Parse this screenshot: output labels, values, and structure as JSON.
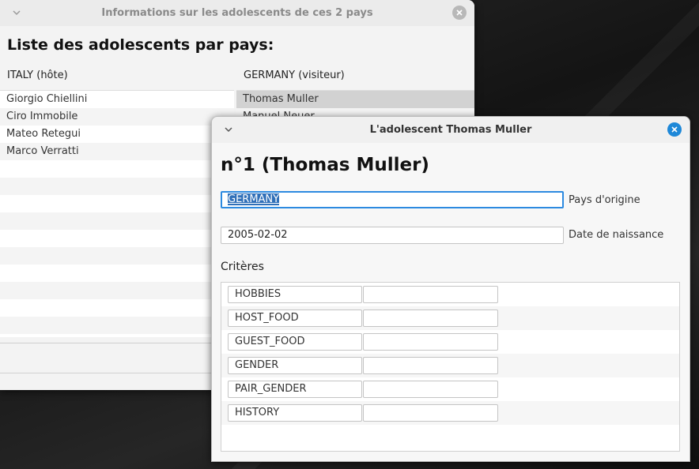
{
  "main_window": {
    "title": "Informations sur les adolescents de ces 2 pays",
    "heading": "Liste des adolescents par pays:",
    "host_label": "ITALY (hôte)",
    "visitor_label": "GERMANY (visiteur)",
    "host_students": [
      "Giorgio Chiellini",
      "Ciro Immobile",
      "Mateo Retegui",
      "Marco Verratti"
    ],
    "visitor_students": [
      "Thomas Muller",
      "Manuel Neuer"
    ]
  },
  "detail_window": {
    "title": "L'adolescent Thomas Muller",
    "heading": "n°1 (Thomas Muller)",
    "country_value": "GERMANY",
    "country_label": "Pays d'origine",
    "birth_value": "2005-02-02",
    "birth_label": "Date de naissance",
    "criteria_label": "Critères",
    "criteria": [
      {
        "key": "HOBBIES",
        "value": ""
      },
      {
        "key": "HOST_FOOD",
        "value": ""
      },
      {
        "key": "GUEST_FOOD",
        "value": ""
      },
      {
        "key": "GENDER",
        "value": ""
      },
      {
        "key": "PAIR_GENDER",
        "value": ""
      },
      {
        "key": "HISTORY",
        "value": ""
      }
    ]
  },
  "colors": {
    "accent": "#1e88d8",
    "selection": "#2f6fb8"
  }
}
